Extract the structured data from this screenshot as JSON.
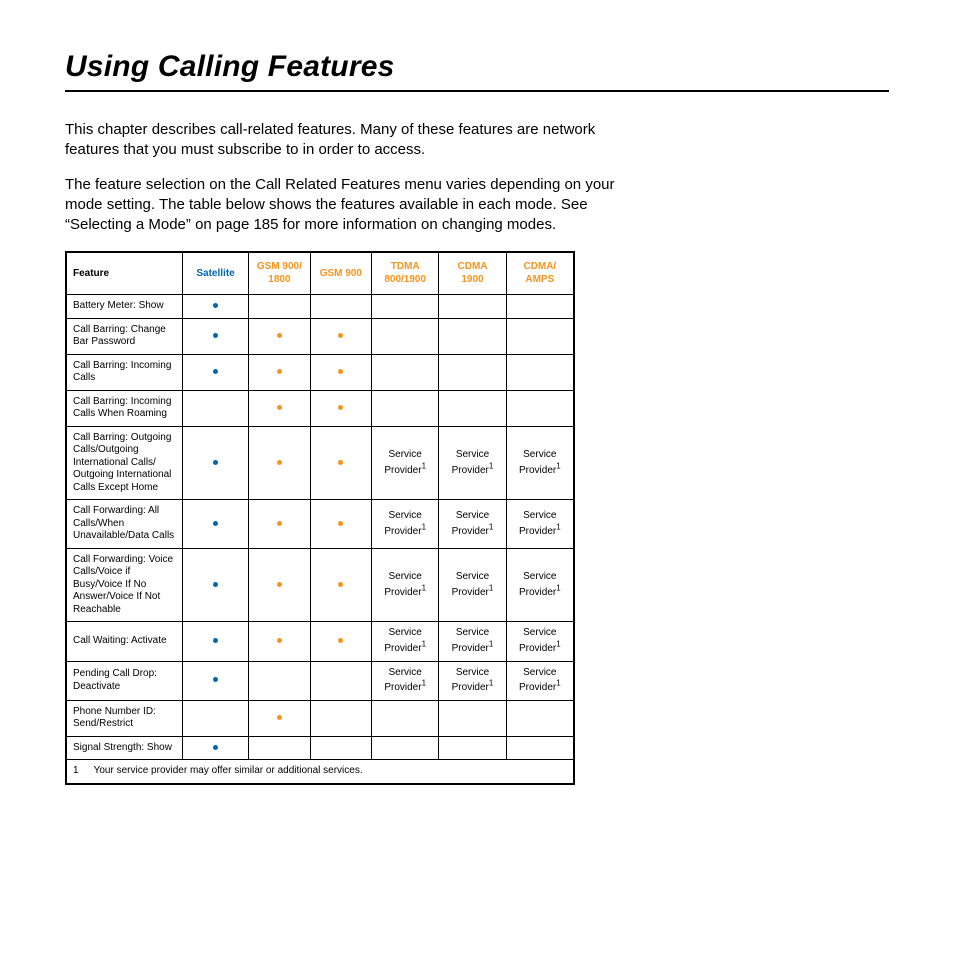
{
  "title": "Using Calling Features",
  "intro1": "This chapter describes call-related features. Many of these features are network features that you must subscribe to in order to access.",
  "intro2": "The feature selection on the Call Related Features menu varies depending on your mode setting. The table below shows the features available in each mode. See “Selecting a Mode” on page 185 for more information on changing modes.",
  "headers": {
    "feature": "Feature",
    "satellite": "Satellite",
    "gsm900_1800": "GSM 900/ 1800",
    "gsm900": "GSM 900",
    "tdma": "TDMA 800/1900",
    "cdma1900": "CDMA 1900",
    "cdma_amps": "CDMA/ AMPS"
  },
  "sp_text": "Service Provider",
  "sp_sup": "1",
  "rows": [
    {
      "feature": "Battery Meter: Show",
      "c": [
        "blue",
        "",
        "",
        "",
        "",
        ""
      ]
    },
    {
      "feature": "Call Barring: Change Bar Password",
      "c": [
        "blue",
        "orange",
        "orange",
        "",
        "",
        ""
      ]
    },
    {
      "feature": "Call Barring: Incoming Calls",
      "c": [
        "blue",
        "orange",
        "orange",
        "",
        "",
        ""
      ]
    },
    {
      "feature": "Call Barring: Incoming Calls When Roaming",
      "c": [
        "",
        "orange",
        "orange",
        "",
        "",
        ""
      ]
    },
    {
      "feature": "Call Barring: Outgoing Calls/Outgoing International Calls/ Outgoing International Calls Except Home",
      "c": [
        "blue",
        "orange",
        "orange",
        "sp",
        "sp",
        "sp"
      ]
    },
    {
      "feature": "Call Forwarding: All Calls/When Unavailable/Data Calls",
      "c": [
        "blue",
        "orange",
        "orange",
        "sp",
        "sp",
        "sp"
      ]
    },
    {
      "feature": "Call Forwarding: Voice Calls/Voice if Busy/Voice If No Answer/Voice If Not Reachable",
      "c": [
        "blue",
        "orange",
        "orange",
        "sp",
        "sp",
        "sp"
      ]
    },
    {
      "feature": "Call Waiting: Activate",
      "c": [
        "blue",
        "orange",
        "orange",
        "sp",
        "sp",
        "sp"
      ]
    },
    {
      "feature": "Pending Call Drop: Deactivate",
      "c": [
        "blue",
        "",
        "",
        "sp",
        "sp",
        "sp"
      ]
    },
    {
      "feature": "Phone Number ID: Send/Restrict",
      "c": [
        "",
        "orange",
        "",
        "",
        "",
        ""
      ]
    },
    {
      "feature": "Signal Strength: Show",
      "c": [
        "blue",
        "",
        "",
        "",
        "",
        ""
      ]
    }
  ],
  "footnote_num": "1",
  "footnote_text": "Your service provider may offer similar or additional services."
}
